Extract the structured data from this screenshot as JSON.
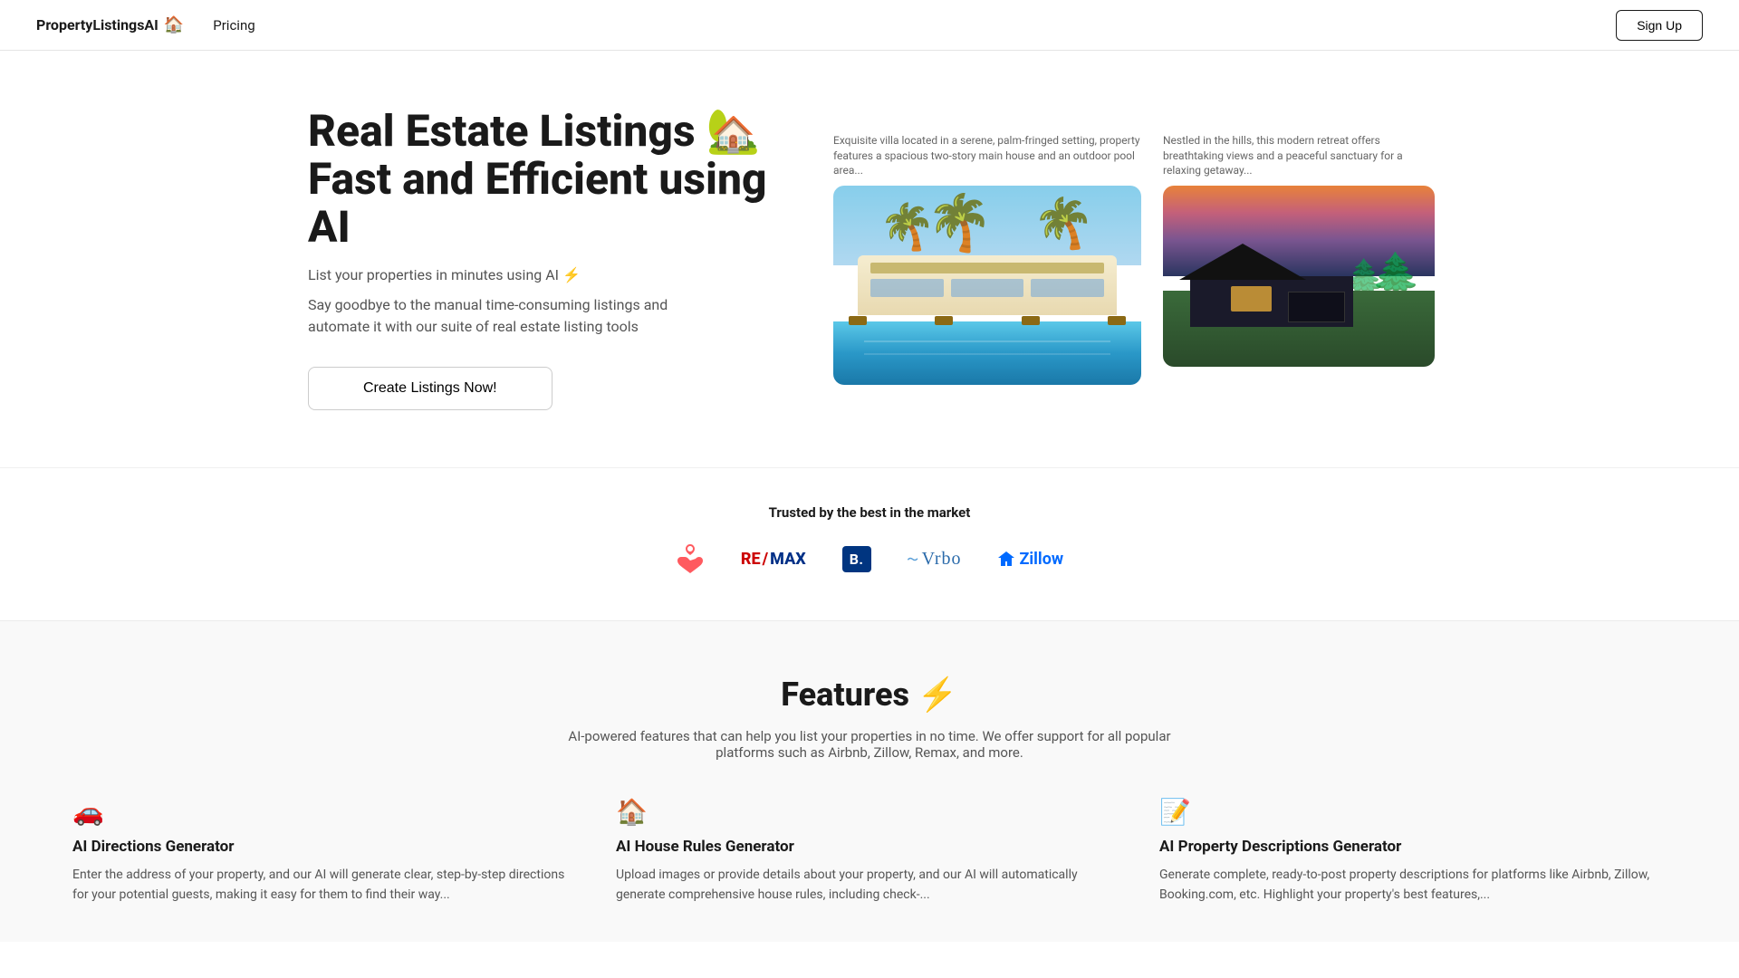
{
  "nav": {
    "brand": "PropertyListingsAI",
    "home_icon": "🏠",
    "pricing_label": "Pricing",
    "signup_label": "Sign Up"
  },
  "hero": {
    "title_line1": "Real Estate Listings 🏡",
    "title_line2": "Fast and Efficient using AI",
    "subtitle": "List your properties in minutes using AI ⚡",
    "description": "Say goodbye to the manual time-consuming listings and automate it with our suite of real estate listing tools",
    "cta_label": "Create Listings Now!",
    "image1_caption": "Exquisite villa located in a serene, palm-fringed setting, property features a spacious two-story main house and an outdoor pool area...",
    "image2_caption": "Nestled in the hills, this modern retreat offers breathtaking views and a peaceful sanctuary for a relaxing getaway..."
  },
  "trusted": {
    "title": "Trusted by the best in the market",
    "brands": [
      {
        "name": "Airbnb",
        "display": "airbnb"
      },
      {
        "name": "RE/MAX",
        "display": "remax"
      },
      {
        "name": "Booking.com",
        "display": "booking"
      },
      {
        "name": "Vrbo",
        "display": "vrbo"
      },
      {
        "name": "Zillow",
        "display": "zillow"
      }
    ]
  },
  "features": {
    "title": "Features ⚡",
    "subtitle": "AI-powered features that can help you list your properties in no time. We offer support for all popular platforms such as Airbnb, Zillow, Remax, and more.",
    "items": [
      {
        "icon": "🚗",
        "name": "AI Directions Generator",
        "description": "Enter the address of your property, and our AI will generate clear, step-by-step directions for your potential guests, making it easy for them to find their way..."
      },
      {
        "icon": "🏠",
        "name": "AI House Rules Generator",
        "description": "Upload images or provide details about your property, and our AI will automatically generate comprehensive house rules, including check-..."
      },
      {
        "icon": "📝",
        "name": "AI Property Descriptions Generator",
        "description": "Generate complete, ready-to-post property descriptions for platforms like Airbnb, Zillow, Booking.com, etc. Highlight your property's best features,..."
      }
    ]
  }
}
